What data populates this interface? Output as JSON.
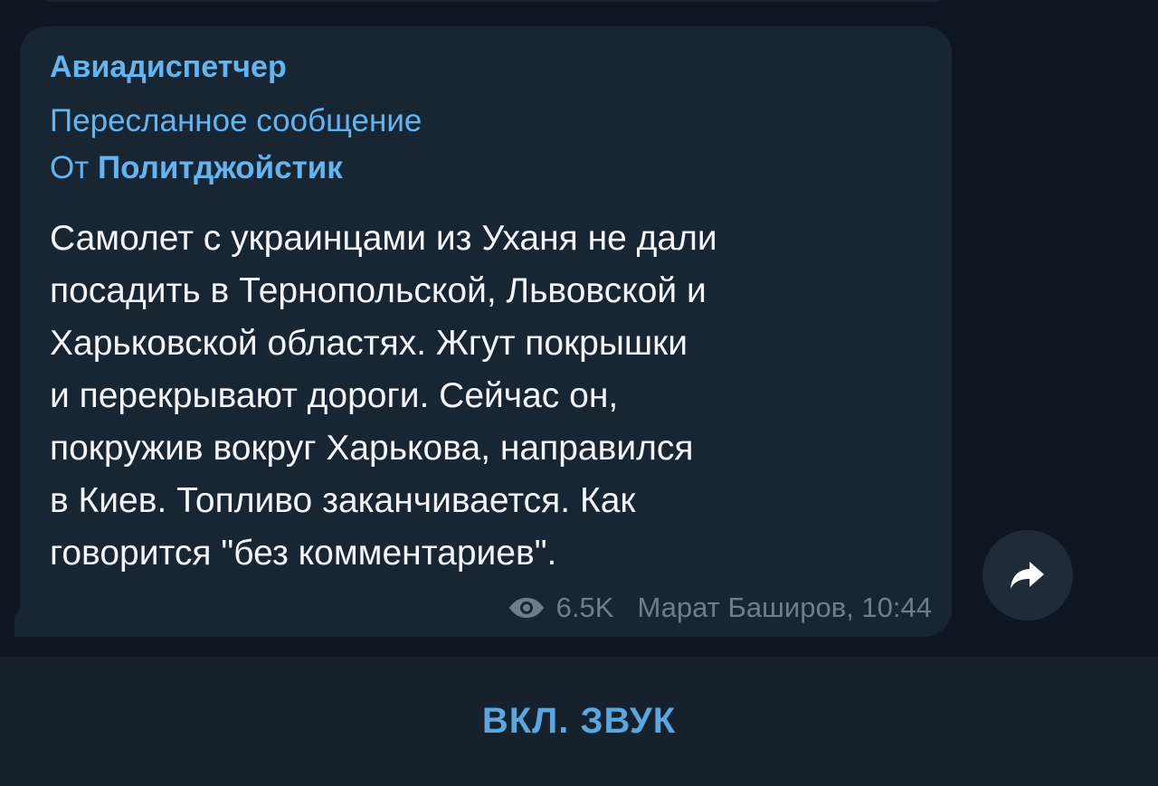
{
  "message": {
    "sender": "Авиадиспетчер",
    "forward_label": "Пересланное сообщение",
    "forward_from_prefix": "От ",
    "forward_from_name": "Политджойстик",
    "text": "Самолет с украинцами из Уханя не дали\nпосадить в Тернопольской, Львовской и\nХарьковской областях. Жгут покрышки\nи перекрывают дороги. Сейчас он,\nпокружив вокруг Харькова, направился\nв Киев. Топливо заканчивается. Как\nговорится \"без комментариев\".",
    "views": "6.5K",
    "signature_time": "Марат Баширов, 10:44",
    "views_icon": "eye-icon"
  },
  "share": {
    "icon": "share-arrow-icon"
  },
  "bottom_bar": {
    "sound_button_label": "ВКЛ. ЗВУК"
  },
  "colors": {
    "background": "#0e1621",
    "bubble": "#182533",
    "accent": "#64b5ef",
    "text": "#f4f5f7",
    "meta": "#6d7f8f",
    "bottom_bar": "#17212b"
  }
}
